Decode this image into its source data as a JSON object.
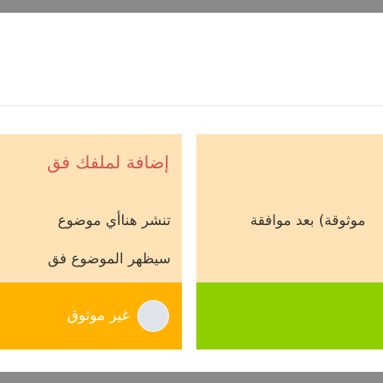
{
  "cards": [
    {
      "title": "إضافة لملفك فق",
      "lines": [
        "تنشر هناأي موضوع",
        "سيظهر الموضوع فق"
      ],
      "status_label": "غير موثوق"
    },
    {
      "lines": [
        "موثوقة) بعد موافقة"
      ]
    }
  ],
  "colors": {
    "card_background": "#ffe3b6",
    "title_red": "#d9534f",
    "footer_orange": "#ffb200",
    "footer_green": "#8fcf00"
  }
}
